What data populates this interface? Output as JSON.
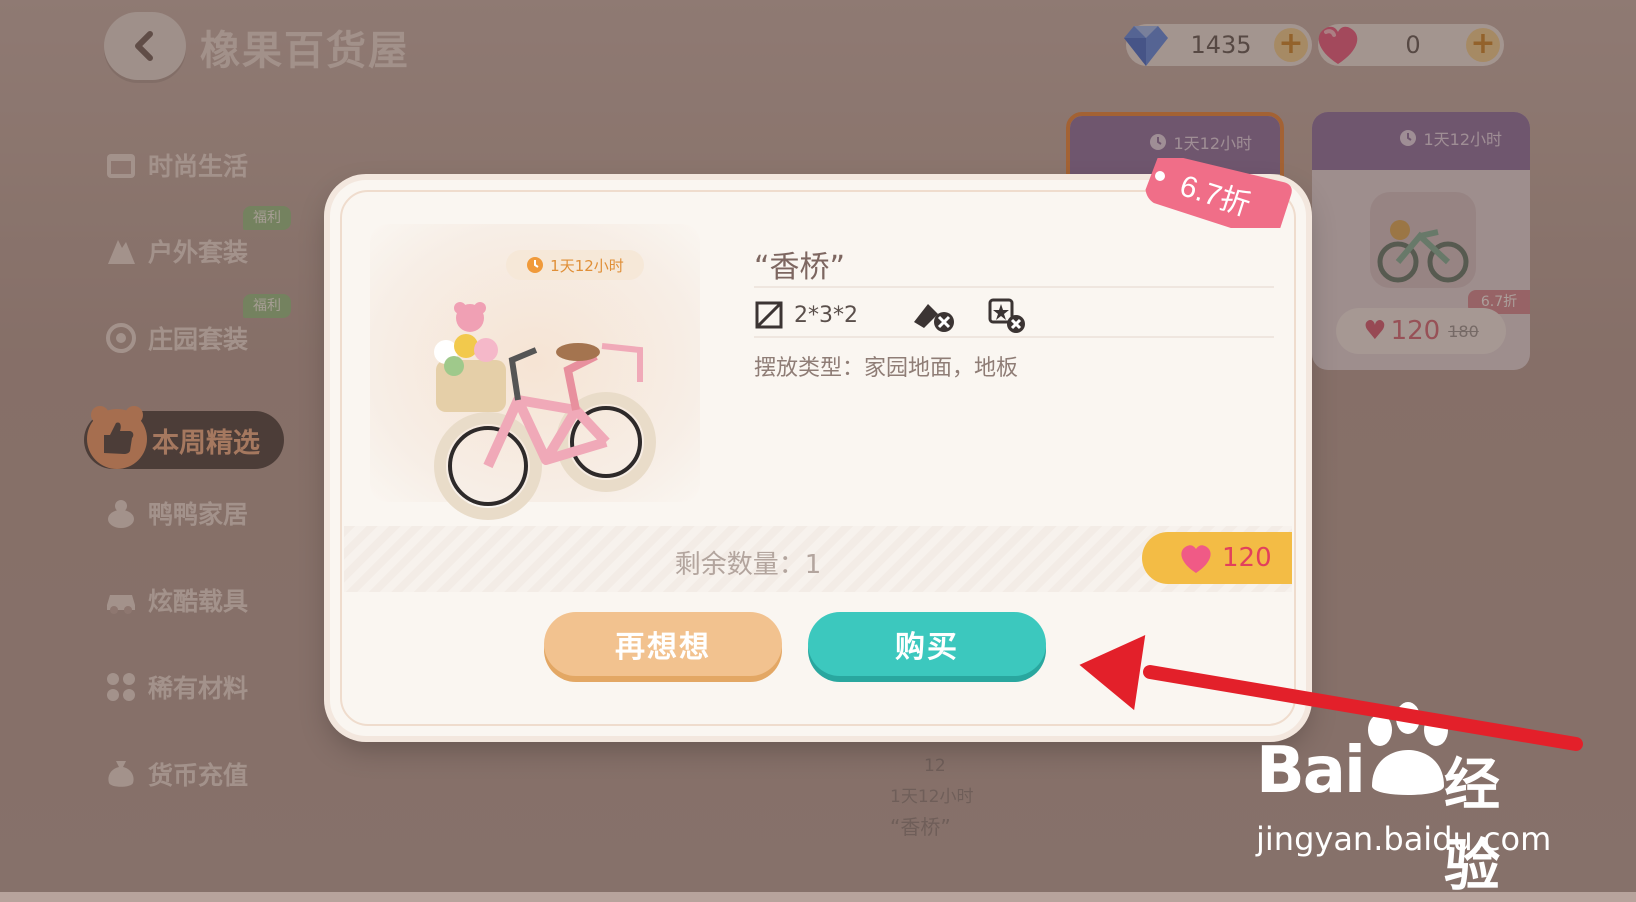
{
  "header": {
    "title": "橡果百货屋",
    "currencies": [
      {
        "name": "blue-gem",
        "amount": "1435",
        "plus": "+"
      },
      {
        "name": "pink-heart",
        "amount": "0",
        "plus": "+"
      }
    ]
  },
  "sidebar": {
    "items": [
      {
        "label": "时尚生活"
      },
      {
        "label": "户外套装",
        "badge": "福利"
      },
      {
        "label": "庄园套装",
        "badge": "福利"
      },
      {
        "label": "本周精选",
        "active": true
      },
      {
        "label": "鸭鸭家居"
      },
      {
        "label": "炫酷载具"
      },
      {
        "label": "稀有材料"
      },
      {
        "label": "货币充值"
      }
    ]
  },
  "cards": [
    {
      "timer": "1天12小时"
    },
    {
      "timer": "1天12小时",
      "price": "120",
      "original_price": "180",
      "discount": "6.7折"
    }
  ],
  "mini_info": {
    "count": "12",
    "timer": "1天12小时",
    "name": "“香桥”"
  },
  "modal": {
    "timer": "1天12小时",
    "discount": "6.7折",
    "item_name": "“香桥”",
    "size": "2*3*2",
    "place_type": "摆放类型：家园地面，地板",
    "stock": "剩余数量：1",
    "price": "120",
    "cancel_label": "再想想",
    "buy_label": "购买"
  },
  "watermark": {
    "brand_text": "Bai",
    "brand_suffix": "经验",
    "url": "jingyan.baidu.com"
  },
  "colors": {
    "buy_button": "#3cc8be",
    "cancel_button": "#f2c28f",
    "price_tag": "#f3bc45",
    "arrow": "#e3202a",
    "active_sidebar": "#4a4442"
  }
}
